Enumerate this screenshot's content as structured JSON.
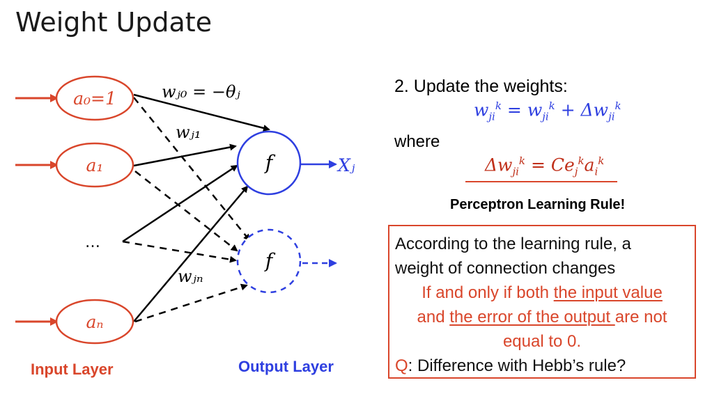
{
  "slide": {
    "title": "Weight Update"
  },
  "diagram": {
    "input_nodes": [
      "a₀=1",
      "a₁",
      "…",
      "aₙ"
    ],
    "output_node_label": "f",
    "output_symbol": "Xⱼ",
    "weight_labels": {
      "w_j0": "wⱼ₀ = −θⱼ",
      "w_j1": "wⱼ₁",
      "w_jn": "wⱼₙ"
    },
    "input_layer_label": "Input Layer",
    "output_layer_label": "Output Layer",
    "colors": {
      "input": "#d9462b",
      "output": "#2e3fe0",
      "edge": "#000000"
    }
  },
  "text": {
    "step": "2.  Update the weights:",
    "update_eq": {
      "lhs": "w",
      "rhs1": "w",
      "delta": "Δw",
      "sup": "k",
      "sub": "ji",
      "eq": "=",
      "plus": "+"
    },
    "where": "where",
    "delta_eq": {
      "lhs": "Δw",
      "sup": "k",
      "sub": "ji",
      "eq": "=",
      "C": "C",
      "e": "e",
      "a": "a",
      "e_sub": "j",
      "a_sub": "i"
    },
    "rule_label": "Perceptron Learning Rule!"
  },
  "box": {
    "line1": "According to the learning rule, a",
    "line2": "weight of connection changes",
    "line3_pre": "If and only if both ",
    "line3_u": "the input value",
    "line4_pre": "and ",
    "line4_u": "the error of the output ",
    "line4_post": "are not",
    "line5": "equal to 0.",
    "q_prefix": "Q",
    "q_text": ": Difference with Hebb’s rule?"
  }
}
